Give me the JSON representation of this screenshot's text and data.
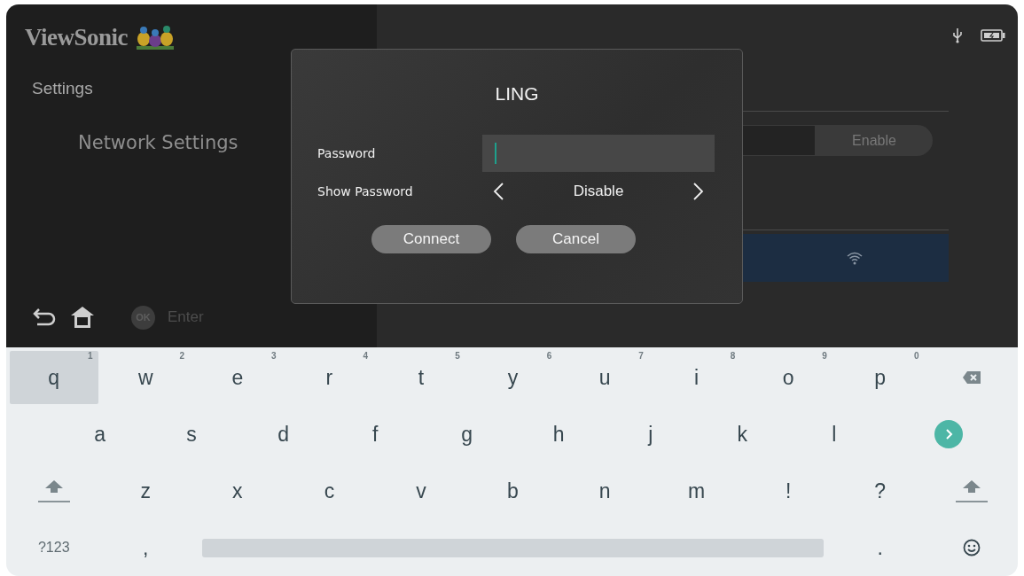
{
  "brand": {
    "name": "ViewSonic"
  },
  "sidebar": {
    "title": "Settings",
    "section": "Network Settings"
  },
  "footer_hints": [
    {
      "kind": "back"
    },
    {
      "kind": "home"
    },
    {
      "kind": "ok",
      "badge": "OK",
      "label": "Enter"
    }
  ],
  "wifi_panel": {
    "toggle": {
      "label": "Enable",
      "selected": true
    }
  },
  "dialog": {
    "title": "LING",
    "fields": [
      {
        "kind": "input",
        "label": "Password",
        "focused": true
      },
      {
        "kind": "selector",
        "label": "Show Password",
        "value": "Disable"
      }
    ],
    "buttons": [
      "Connect",
      "Cancel"
    ]
  },
  "keyboard": {
    "rows": [
      [
        {
          "kind": "char",
          "label": "q",
          "hint": "1",
          "selected": true
        },
        {
          "kind": "char",
          "label": "w",
          "hint": "2",
          "selected": false
        },
        {
          "kind": "char",
          "label": "e",
          "hint": "3",
          "selected": false
        },
        {
          "kind": "char",
          "label": "r",
          "hint": "4",
          "selected": false
        },
        {
          "kind": "char",
          "label": "t",
          "hint": "5",
          "selected": false
        },
        {
          "kind": "char",
          "label": "y",
          "hint": "6",
          "selected": false
        },
        {
          "kind": "char",
          "label": "u",
          "hint": "7",
          "selected": false
        },
        {
          "kind": "char",
          "label": "i",
          "hint": "8",
          "selected": false
        },
        {
          "kind": "char",
          "label": "o",
          "hint": "9",
          "selected": false
        },
        {
          "kind": "char",
          "label": "p",
          "hint": "0",
          "selected": false
        },
        {
          "kind": "backspace",
          "selected": false
        }
      ],
      [
        {
          "kind": "gap"
        },
        {
          "kind": "char",
          "label": "a",
          "selected": false
        },
        {
          "kind": "char",
          "label": "s",
          "selected": false
        },
        {
          "kind": "char",
          "label": "d",
          "selected": false
        },
        {
          "kind": "char",
          "label": "f",
          "selected": false
        },
        {
          "kind": "char",
          "label": "g",
          "selected": false
        },
        {
          "kind": "char",
          "label": "h",
          "selected": false
        },
        {
          "kind": "char",
          "label": "j",
          "selected": false
        },
        {
          "kind": "char",
          "label": "k",
          "selected": false
        },
        {
          "kind": "char",
          "label": "l",
          "selected": false
        },
        {
          "kind": "enter",
          "selected": false
        }
      ],
      [
        {
          "kind": "shift",
          "selected": false
        },
        {
          "kind": "char",
          "label": "z",
          "selected": false
        },
        {
          "kind": "char",
          "label": "x",
          "selected": false
        },
        {
          "kind": "char",
          "label": "c",
          "selected": false
        },
        {
          "kind": "char",
          "label": "v",
          "selected": false
        },
        {
          "kind": "char",
          "label": "b",
          "selected": false
        },
        {
          "kind": "char",
          "label": "n",
          "selected": false
        },
        {
          "kind": "char",
          "label": "m",
          "selected": false
        },
        {
          "kind": "char",
          "label": "!",
          "selected": false
        },
        {
          "kind": "char",
          "label": "?",
          "selected": false
        },
        {
          "kind": "shift",
          "selected": false
        }
      ],
      [
        {
          "kind": "symbols",
          "label": "?123",
          "selected": false
        },
        {
          "kind": "char",
          "label": ",",
          "selected": false
        },
        {
          "kind": "space",
          "selected": false
        },
        "",
        "",
        "",
        "",
        "",
        "",
        {
          "kind": "char",
          "label": ".",
          "selected": false
        },
        {
          "kind": "emoji",
          "selected": false
        }
      ]
    ]
  }
}
